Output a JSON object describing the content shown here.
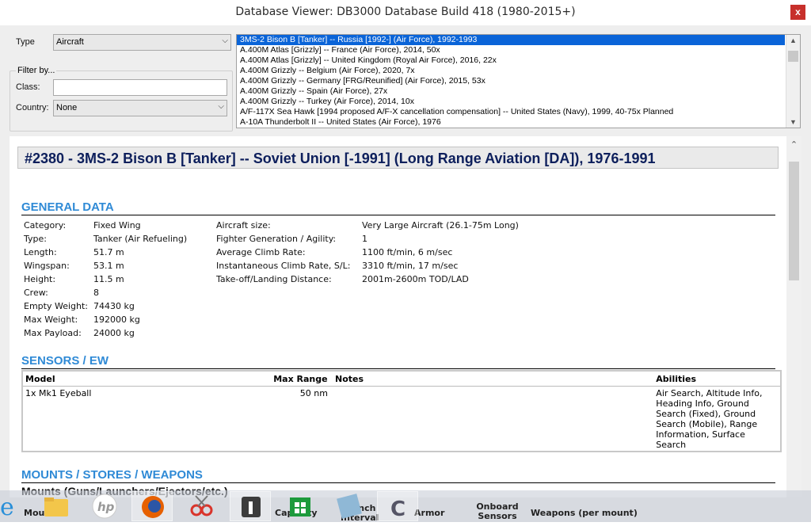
{
  "window": {
    "title": "Database Viewer: DB3000 Database Build 418 (1980-2015+)",
    "close_label": "x"
  },
  "filters": {
    "type_label": "Type",
    "type_value": "Aircraft",
    "filter_by_label": "Filter by...",
    "class_label": "Class:",
    "class_value": "",
    "country_label": "Country:",
    "country_value": "None"
  },
  "unit_list": [
    "3MS-2 Bison B [Tanker] -- Russia [1992-] (Air Force), 1992-1993",
    "A.400M Atlas [Grizzly] -- France (Air Force), 2014, 50x",
    "A.400M Atlas [Grizzly] -- United Kingdom (Royal Air Force), 2016, 22x",
    "A.400M Grizzly -- Belgium (Air Force), 2020, 7x",
    "A.400M Grizzly -- Germany [FRG/Reunified] (Air Force), 2015, 53x",
    "A.400M Grizzly -- Spain (Air Force), 27x",
    "A.400M Grizzly -- Turkey (Air Force), 2014, 10x",
    "A/F-117X Sea Hawk [1994 proposed A/F-X cancellation compensation] -- United States (Navy), 1999, 40-75x Planned",
    "A-10A Thunderbolt II -- United States (Air Force), 1976"
  ],
  "detail": {
    "heading": "#2380 - 3MS-2 Bison B [Tanker] -- Soviet Union [-1991] (Long Range Aviation [DA]), 1976-1991",
    "general_title": "GENERAL DATA",
    "general_left": [
      {
        "k": "Category:",
        "v": "Fixed Wing"
      },
      {
        "k": "Type:",
        "v": "Tanker (Air Refueling)"
      },
      {
        "k": "Length:",
        "v": "51.7 m"
      },
      {
        "k": "Wingspan:",
        "v": "53.1 m"
      },
      {
        "k": "Height:",
        "v": "11.5 m"
      },
      {
        "k": "Crew:",
        "v": "8"
      },
      {
        "k": "Empty Weight:",
        "v": "74430 kg"
      },
      {
        "k": "Max Weight:",
        "v": "192000 kg"
      },
      {
        "k": "Max Payload:",
        "v": "24000 kg"
      }
    ],
    "general_right": [
      {
        "k": "Aircraft size:",
        "v": "Very Large Aircraft (26.1-75m Long)"
      },
      {
        "k": "Fighter Generation / Agility:",
        "v": "1"
      },
      {
        "k": "Average Climb Rate:",
        "v": "1100 ft/min, 6 m/sec"
      },
      {
        "k": "Instantaneous Climb Rate, S/L:",
        "v": "3310 ft/min, 17 m/sec"
      },
      {
        "k": "Take-off/Landing Distance:",
        "v": "2001m-2600m TOD/LAD"
      }
    ],
    "sensors_title": "SENSORS / EW",
    "sensors_columns": [
      "Model",
      "Max Range",
      "Notes",
      "Abilities"
    ],
    "sensors_rows": [
      {
        "model": "1x Mk1 Eyeball",
        "range": "50 nm",
        "notes": "",
        "abilities": "Air Search, Altitude Info, Heading Info, Ground Search (Fixed), Ground Search (Mobile), Range Information, Surface Search"
      }
    ],
    "mounts_title": "MOUNTS / STORES / WEAPONS",
    "mounts_subtitle": "Mounts (Guns/Launchers/Ejectors/etc.)",
    "mounts_columns": [
      "Mou",
      "Capacity",
      "Launch Interval",
      "Armor",
      "Onboard Sensors",
      "Weapons (per mount)"
    ]
  },
  "taskbar": [
    "internet-explorer-icon",
    "file-explorer-icon",
    "hp-icon",
    "firefox-icon",
    "snipping-tool-icon",
    "touch-app-icon",
    "store-icon",
    "notepad-icon",
    "game-app-icon"
  ],
  "colors": {
    "section": "#2f8ad6",
    "selection": "#0a64d8",
    "heading": "#0d1f5c",
    "close": "#c7302b"
  }
}
